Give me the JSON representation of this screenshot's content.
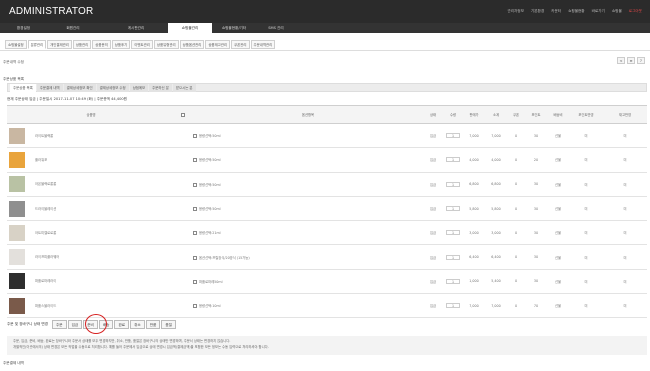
{
  "app": {
    "title": "ADMINISTRATOR"
  },
  "top_links": [
    "관리자정보",
    "기본환경",
    "카운터",
    "쇼핑몰현황",
    "바로가기",
    "쇼핑몰",
    "로그아웃"
  ],
  "main_tabs": [
    "환경설정",
    "회원관리",
    "게시판관리",
    "쇼핑몰관리",
    "쇼핑몰현황/기타",
    "SMS 관리"
  ],
  "main_tabs_active_index": 3,
  "sub_tabs": [
    "쇼핑몰설정",
    "분류관리",
    "개인결제관리",
    "상품관리",
    "상품문의",
    "상품후기",
    "이벤트관리",
    "상품유형관리",
    "상품옵션관리",
    "상품재고관리",
    "쿠폰관리",
    "주문내역관리"
  ],
  "sub_tabs_active_index": 1,
  "breadcrumb": "주문내역 수정",
  "right_buttons": [
    "<",
    "≡",
    "?"
  ],
  "section_title": "주문상품 목록",
  "filter_tabs": [
    "주문상품 목록",
    "주문결제 내역",
    "결제상세정보 확인",
    "결제상세정보 수정",
    "상점메모",
    "주문하신 분",
    "받으시는 분"
  ],
  "filter_tabs_active_index": 0,
  "order_info": "현재 주문상태 입금 | 주문일시 2017-11-07 10:49 (화) | 주문총액 44,400원",
  "table": {
    "headers": [
      "상품명",
      "",
      "옵션항목",
      "상태",
      "수량",
      "판매가",
      "소계",
      "쿠폰",
      "포인트",
      "배송비",
      "포인트반영",
      "재고반영"
    ],
    "rows": [
      {
        "name": "라이트블랙롱",
        "option": "용량선택:50ml",
        "status": "입금",
        "qty": "1",
        "price": "7,000",
        "subtotal": "7,000",
        "coupon": "0",
        "point": "30",
        "ship": "선불",
        "point_applied": "미",
        "stock_applied": "미",
        "thumb_color": "#c9b7a2"
      },
      {
        "name": "플라워포",
        "option": "용량선택:50ml",
        "status": "입금",
        "qty": "1",
        "price": "4,000",
        "subtotal": "4,000",
        "coupon": "0",
        "point": "20",
        "ship": "선불",
        "point_applied": "미",
        "stock_applied": "미",
        "thumb_color": "#e9a43c"
      },
      {
        "name": "아몬블랙로롱롱",
        "option": "용량선택:50ml",
        "status": "입금",
        "qty": "1",
        "price": "6,800",
        "subtotal": "6,800",
        "coupon": "0",
        "point": "30",
        "ship": "선불",
        "point_applied": "미",
        "stock_applied": "미",
        "thumb_color": "#b9c2a4"
      },
      {
        "name": "드라이블레이션",
        "option": "용량선택:50ml",
        "status": "입금",
        "qty": "1",
        "price": "5,800",
        "subtotal": "5,800",
        "coupon": "0",
        "point": "30",
        "ship": "선불",
        "point_applied": "미",
        "stock_applied": "미",
        "thumb_color": "#8f8f8f"
      },
      {
        "name": "아트미젤로로롱",
        "option": "용량선택:21ml",
        "status": "입금",
        "qty": "1",
        "price": "3,000",
        "subtotal": "3,000",
        "coupon": "0",
        "point": "30",
        "ship": "선불",
        "point_applied": "미",
        "stock_applied": "미",
        "thumb_color": "#d8d2c6"
      },
      {
        "name": "라이프피플라웨어",
        "option": "옵션선택:프릴장식/20방식 (15가능)",
        "status": "입금",
        "qty": "1",
        "price": "6,400",
        "subtotal": "6,400",
        "coupon": "0",
        "point": "30",
        "ship": "선불",
        "point_applied": "미",
        "stock_applied": "미",
        "thumb_color": "#e3e0dc"
      },
      {
        "name": "퍼퓸로마레라이",
        "option": "퍼퓸로마레50ml",
        "status": "입금",
        "qty": "1",
        "price": "1,000",
        "subtotal": "5,400",
        "coupon": "0",
        "point": "30",
        "ship": "선불",
        "point_applied": "미",
        "stock_applied": "미",
        "thumb_color": "#2e2e2e"
      },
      {
        "name": "퍼퓸스블라이드",
        "option": "용량선택:10ml",
        "status": "입금",
        "qty": "1",
        "price": "7,000",
        "subtotal": "7,000",
        "coupon": "0",
        "point": "70",
        "ship": "선불",
        "point_applied": "미",
        "stock_applied": "미",
        "thumb_color": "#7a5a4a"
      }
    ]
  },
  "status_bar": {
    "label": "주문 및 장바구니 상태 변경",
    "buttons": [
      "주문",
      "입금",
      "준비",
      "배송",
      "완료",
      "취소",
      "반품",
      "품절"
    ]
  },
  "notice": [
    "주문, 입금, 준비, 배송, 완료는 장바구니와 주문서 상태를 모두 변경하지만, 취소, 반품, 품절은 장바구니의 상태만 변경하며, 주문서 상태는 변경하지 않습니다.",
    "개별적인(이곳에서의) 상태 변경은 모든 작업을 수동으로 처리합니다. 예를 들어 주문에서 입금으로 상태 변경시 입금액(결제금액)을 포함한 모든 정보는 수동 입력으로 처리하셔야 합니다."
  ],
  "section2_title": "주문결제 내역"
}
